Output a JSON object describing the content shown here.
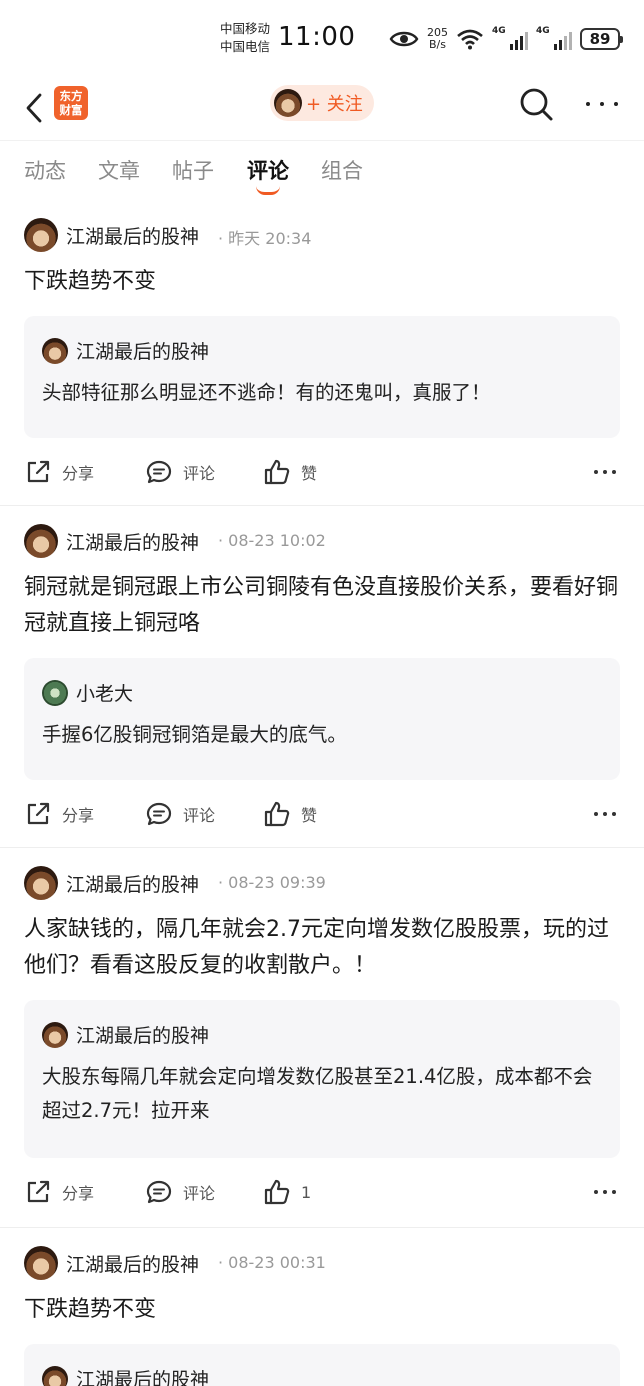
{
  "status_bar": {
    "carrier1": "中国移动",
    "carrier2": "中国电信",
    "time": "11:00",
    "net_speed": "205",
    "net_unit": "B/s",
    "sig1": "4G",
    "sig2": "4G",
    "battery": "89"
  },
  "header": {
    "logo_line1": "东方",
    "logo_line2": "财富",
    "follow_label": "+ 关注"
  },
  "tabs": [
    "动态",
    "文章",
    "帖子",
    "评论",
    "组合"
  ],
  "active_tab": "评论",
  "posts": [
    {
      "author": "江湖最后的股神",
      "time": "· 昨天 20:34",
      "body": "下跌趋势不变",
      "quote_author": "江湖最后的股神",
      "quote_text": "头部特征那么明显还不逃命！有的还鬼叫，真服了！",
      "share": "分享",
      "comment": "评论",
      "like": "赞"
    },
    {
      "author": "江湖最后的股神",
      "time": "· 08-23 10:02",
      "body": "铜冠就是铜冠跟上市公司铜陵有色没直接股价关系，要看好铜冠就直接上铜冠咯",
      "quote_author": "小老大",
      "quote_text": "手握6亿股铜冠铜箔是最大的底气。",
      "share": "分享",
      "comment": "评论",
      "like": "赞"
    },
    {
      "author": "江湖最后的股神",
      "time": "· 08-23 09:39",
      "body": "人家缺钱的，隔几年就会2.7元定向增发数亿股股票，玩的过他们？看看这股反复的收割散户。！",
      "quote_author": "江湖最后的股神",
      "quote_text": "大股东每隔几年就会定向增发数亿股甚至21.4亿股，成本都不会超过2.7元！拉开来",
      "share": "分享",
      "comment": "评论",
      "like": "1"
    },
    {
      "author": "江湖最后的股神",
      "time": "· 08-23 00:31",
      "body": "下跌趋势不变",
      "quote_author": "江湖最后的股神"
    }
  ]
}
